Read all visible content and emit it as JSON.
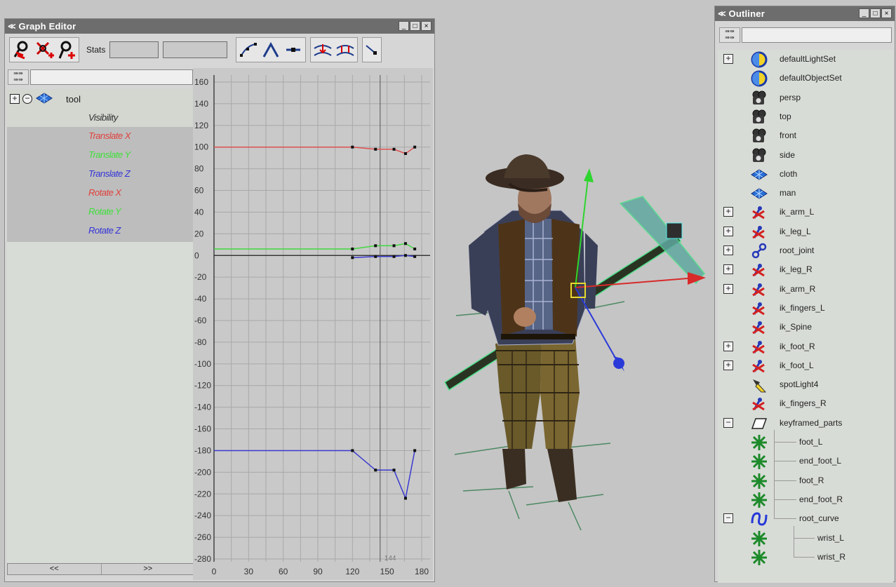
{
  "graph_editor": {
    "title": "Graph Editor",
    "window_controls": [
      "_",
      "□",
      "×"
    ],
    "stats_label": "Stats",
    "stats_value_1": "",
    "stats_value_2": "",
    "filter_text": "",
    "tree_root": {
      "label": "tool"
    },
    "attributes": [
      {
        "label": "Visibility",
        "color": "#333333"
      },
      {
        "label": "Translate X",
        "color": "#e0403c"
      },
      {
        "label": "Translate Y",
        "color": "#3ee03a"
      },
      {
        "label": "Translate Z",
        "color": "#3434d8"
      },
      {
        "label": "Rotate X",
        "color": "#e0403c"
      },
      {
        "label": "Rotate Y",
        "color": "#3ee03a"
      },
      {
        "label": "Rotate Z",
        "color": "#3434d8"
      }
    ],
    "scroll_left": "<<",
    "scroll_right": ">>"
  },
  "chart_data": {
    "type": "line",
    "xlim": [
      0,
      180
    ],
    "ylim": [
      -280,
      160
    ],
    "x_ticks": [
      0,
      30,
      60,
      90,
      120,
      150,
      180
    ],
    "y_ticks": [
      160,
      140,
      120,
      100,
      80,
      60,
      40,
      20,
      0,
      -20,
      -40,
      -60,
      -80,
      -100,
      -120,
      -140,
      -160,
      -180,
      -200,
      -220,
      -240,
      -260,
      -280
    ],
    "current_frame": 144,
    "current_frame_label": "144",
    "grid": true,
    "series": [
      {
        "color": "#e05050",
        "points": [
          [
            0,
            100
          ],
          [
            120,
            100
          ],
          [
            140,
            98
          ],
          [
            156,
            98
          ],
          [
            166,
            94
          ],
          [
            174,
            100
          ]
        ]
      },
      {
        "color": "#40d840",
        "points": [
          [
            0,
            6
          ],
          [
            120,
            6
          ],
          [
            140,
            9
          ],
          [
            156,
            9
          ],
          [
            166,
            11
          ],
          [
            174,
            6
          ]
        ]
      },
      {
        "color": "#3a3ad0",
        "points": [
          [
            120,
            -2
          ],
          [
            140,
            -1
          ],
          [
            156,
            -1
          ],
          [
            166,
            0
          ],
          [
            174,
            -1
          ]
        ]
      },
      {
        "color": "#3a3ad0",
        "points": [
          [
            0,
            -180
          ],
          [
            120,
            -180
          ],
          [
            140,
            -198
          ],
          [
            156,
            -198
          ],
          [
            166,
            -224
          ],
          [
            174,
            -180
          ]
        ]
      }
    ]
  },
  "outliner": {
    "title": "Outliner",
    "window_controls": [
      "_",
      "□",
      "×"
    ],
    "filter_text": "",
    "items": [
      {
        "label": "defaultLightSet",
        "icon": "set-icon",
        "expander": "+",
        "depth": 0
      },
      {
        "label": "defaultObjectSet",
        "icon": "set-icon",
        "expander": "",
        "depth": 0
      },
      {
        "label": "persp",
        "icon": "camera-icon",
        "expander": "",
        "depth": 0
      },
      {
        "label": "top",
        "icon": "camera-icon",
        "expander": "",
        "depth": 0
      },
      {
        "label": "front",
        "icon": "camera-icon",
        "expander": "",
        "depth": 0
      },
      {
        "label": "side",
        "icon": "camera-icon",
        "expander": "",
        "depth": 0
      },
      {
        "label": "cloth",
        "icon": "mesh-icon",
        "expander": "",
        "depth": 0
      },
      {
        "label": "man",
        "icon": "mesh-icon",
        "expander": "",
        "depth": 0
      },
      {
        "label": "ik_arm_L",
        "icon": "ik-handle-icon",
        "expander": "+",
        "depth": 0
      },
      {
        "label": "ik_leg_L",
        "icon": "ik-handle-icon",
        "expander": "+",
        "depth": 0
      },
      {
        "label": "root_joint",
        "icon": "joint-icon",
        "expander": "+",
        "depth": 0
      },
      {
        "label": "ik_leg_R",
        "icon": "ik-handle-icon",
        "expander": "+",
        "depth": 0
      },
      {
        "label": "ik_arm_R",
        "icon": "ik-handle-icon",
        "expander": "+",
        "depth": 0
      },
      {
        "label": "ik_fingers_L",
        "icon": "ik-handle-icon",
        "expander": "",
        "depth": 0
      },
      {
        "label": "ik_Spine",
        "icon": "ik-handle-icon",
        "expander": "",
        "depth": 0
      },
      {
        "label": "ik_foot_R",
        "icon": "ik-handle-icon",
        "expander": "+",
        "depth": 0
      },
      {
        "label": "ik_foot_L",
        "icon": "ik-handle-icon",
        "expander": "+",
        "depth": 0
      },
      {
        "label": "spotLight4",
        "icon": "spotlight-icon",
        "expander": "",
        "depth": 0
      },
      {
        "label": "ik_fingers_R",
        "icon": "ik-handle-icon",
        "expander": "",
        "depth": 0
      },
      {
        "label": "keyframed_parts",
        "icon": "group-icon",
        "expander": "−",
        "depth": 0
      },
      {
        "label": "foot_L",
        "icon": "locator-icon",
        "expander": "",
        "depth": 1
      },
      {
        "label": "end_foot_L",
        "icon": "locator-icon",
        "expander": "",
        "depth": 1
      },
      {
        "label": "foot_R",
        "icon": "locator-icon",
        "expander": "",
        "depth": 1
      },
      {
        "label": "end_foot_R",
        "icon": "locator-icon",
        "expander": "",
        "depth": 1
      },
      {
        "label": "root_curve",
        "icon": "curve-icon",
        "expander": "−",
        "depth": 1
      },
      {
        "label": "wrist_L",
        "icon": "locator-icon",
        "expander": "",
        "depth": 2
      },
      {
        "label": "wrist_R",
        "icon": "locator-icon",
        "expander": "",
        "depth": 2
      }
    ]
  }
}
